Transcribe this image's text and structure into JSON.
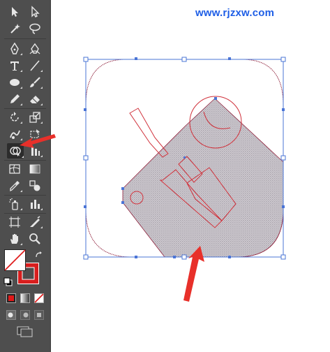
{
  "watermark": {
    "text": "www.rjzxw.com"
  },
  "colors": {
    "toolbar_bg": "#4e4e4e",
    "icon": "#d8d8d8",
    "selection": "#4a74d6",
    "path_stroke": "#8e1f3a",
    "fill_hatch": "#b0b0b0",
    "red_path": "#d0303a",
    "arrow": "#e8302a",
    "fill_swatch": "#ffffff",
    "stroke_swatch": "#d81e1e"
  },
  "tools": [
    {
      "name": "selection-tool-icon"
    },
    {
      "name": "direct-selection-tool-icon"
    },
    {
      "name": "magic-wand-tool-icon"
    },
    {
      "name": "lasso-tool-icon"
    },
    {
      "name": "pen-tool-icon"
    },
    {
      "name": "curvature-tool-icon"
    },
    {
      "name": "type-tool-icon"
    },
    {
      "name": "line-segment-tool-icon"
    },
    {
      "name": "ellipse-tool-icon"
    },
    {
      "name": "paintbrush-tool-icon"
    },
    {
      "name": "pencil-tool-icon"
    },
    {
      "name": "eraser-tool-icon"
    },
    {
      "name": "rotate-tool-icon"
    },
    {
      "name": "scale-tool-icon"
    },
    {
      "name": "warp-tool-icon"
    },
    {
      "name": "free-transform-tool-icon"
    },
    {
      "name": "shape-builder-tool-icon"
    },
    {
      "name": "graph-tool-icon"
    },
    {
      "name": "mesh-tool-icon"
    },
    {
      "name": "gradient-tool-icon"
    },
    {
      "name": "eyedropper-tool-icon"
    },
    {
      "name": "blend-tool-icon"
    },
    {
      "name": "symbol-sprayer-tool-icon"
    },
    {
      "name": "column-graph-tool-icon"
    },
    {
      "name": "artboard-tool-icon"
    },
    {
      "name": "slice-tool-icon"
    },
    {
      "name": "hand-tool-icon"
    },
    {
      "name": "zoom-tool-icon"
    }
  ]
}
